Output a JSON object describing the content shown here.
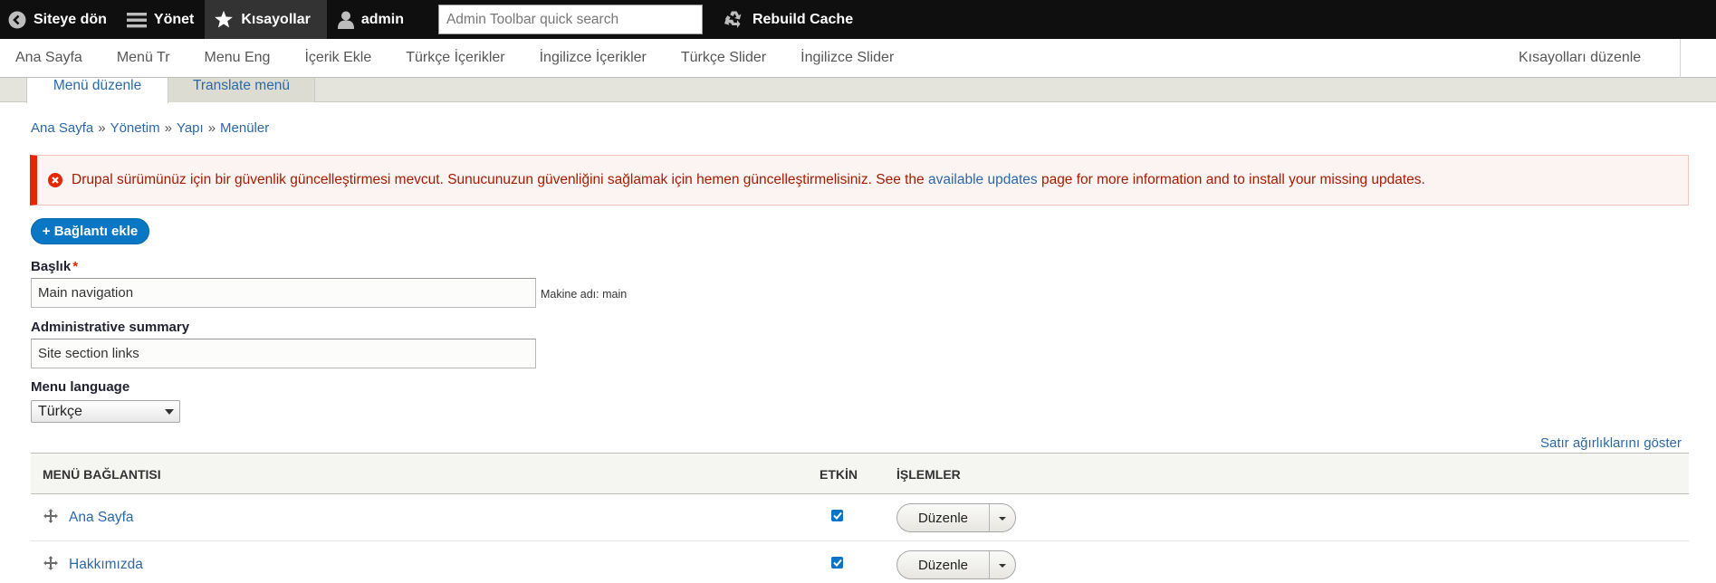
{
  "toolbar": {
    "back_label": "Siteye dön",
    "manage_label": "Yönet",
    "shortcuts_label": "Kısayollar",
    "user_label": "admin",
    "search_placeholder": "Admin Toolbar quick search",
    "rebuild_label": "Rebuild Cache"
  },
  "tray": {
    "links": [
      "Ana Sayfa",
      "Menü Tr",
      "Menu Eng",
      "İçerik Ekle",
      "Türkçe İçerikler",
      "İngilizce İçerikler",
      "Türkçe Slider",
      "İngilizce Slider"
    ],
    "edit_shortcuts": "Kısayolları düzenle"
  },
  "tabs": {
    "active": "Menü düzenle",
    "second": "Translate menü"
  },
  "breadcrumb": {
    "items": [
      "Ana Sayfa",
      "Yönetim",
      "Yapı",
      "Menüler"
    ],
    "separator": "»"
  },
  "message": {
    "text_before": "Drupal sürümünüz için bir güvenlik güncelleştirmesi mevcut. Sunucunuzun güvenliğini sağlamak için hemen güncelleştirmelisiniz. See the ",
    "link": "available updates",
    "text_after": " page for more information and to install your missing updates."
  },
  "add_link_button": "+ Bağlantı ekle",
  "form": {
    "title_label": "Başlık",
    "required_mark": "*",
    "title_value": "Main navigation",
    "machine_name": "Makine adı: main",
    "summary_label": "Administrative summary",
    "summary_value": "Site section links",
    "language_label": "Menu language",
    "language_value": "Türkçe"
  },
  "show_weights": "Satır ağırlıklarını göster",
  "table": {
    "headers": [
      "MENÜ BAĞLANTISI",
      "ETKİN",
      "İŞLEMLER"
    ],
    "rows": [
      {
        "title": "Ana Sayfa",
        "enabled": true,
        "operation": "Düzenle"
      },
      {
        "title": "Hakkımızda",
        "enabled": true,
        "operation": "Düzenle"
      }
    ]
  },
  "colors": {
    "toolbar_bg": "#0f0f0f",
    "link_blue": "#2c68a8",
    "primary_button": "#0a77c4",
    "error_red": "#e62600",
    "error_text": "#a51b00"
  },
  "icons": [
    "back-circle-icon",
    "hamburger-icon",
    "star-icon",
    "user-icon",
    "recycle-icon",
    "error-icon",
    "drag-handle-icon",
    "checkmark-icon",
    "chevron-down-icon"
  ]
}
